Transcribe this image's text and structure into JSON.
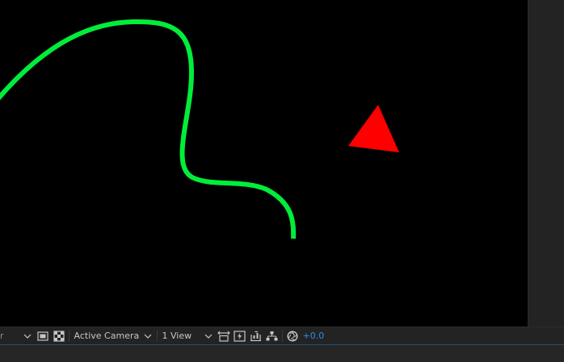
{
  "composition_viewer": {
    "background_color": "#000000",
    "layers": [
      {
        "name": "stroke-path",
        "color": "#00ee3a"
      },
      {
        "name": "triangle-shape",
        "color": "#ff0000"
      }
    ]
  },
  "toolbar": {
    "renderer_dropdown_label": "r",
    "view_dropdown_label": "Active Camera",
    "layout_dropdown_label": "1 View",
    "exposure_value": "+0.0",
    "icons": {
      "region_of_interest": "region-of-interest-icon",
      "transparency_grid": "transparency-grid-icon",
      "toggle_pixel_aspect": "pixel-aspect-icon",
      "fast_previews": "fast-previews-icon",
      "timeline": "timeline-icon",
      "flowchart": "flowchart-icon",
      "reset_exposure": "reset-exposure-icon"
    },
    "accent_color": "#2d8ceb"
  }
}
